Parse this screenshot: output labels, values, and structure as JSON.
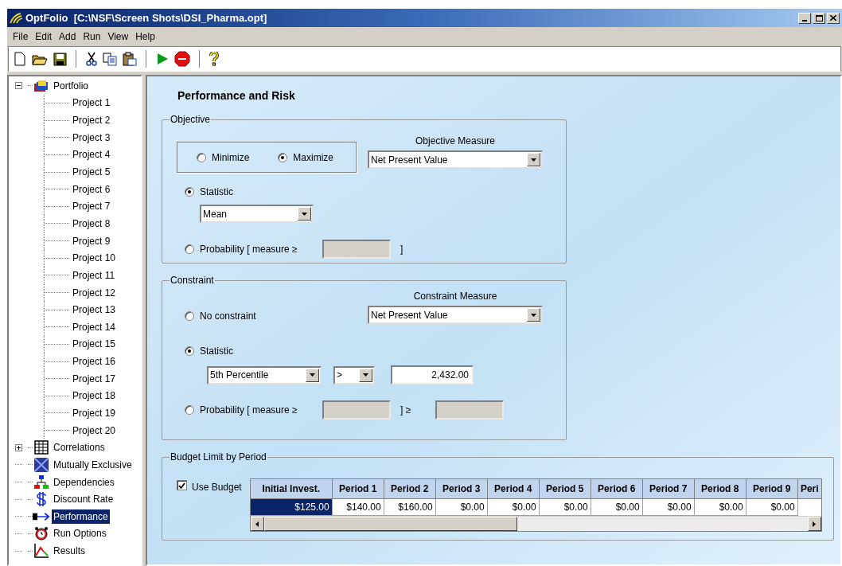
{
  "window": {
    "title": "OptFolio  [C:\\NSF\\Screen Shots\\DSI_Pharma.opt]"
  },
  "menu": [
    "File",
    "Edit",
    "Add",
    "Run",
    "View",
    "Help"
  ],
  "toolbar": [
    {
      "kind": "new"
    },
    {
      "kind": "open"
    },
    {
      "kind": "save"
    },
    {
      "kind": "separator"
    },
    {
      "kind": "cut"
    },
    {
      "kind": "copy"
    },
    {
      "kind": "paste"
    },
    {
      "kind": "separator"
    },
    {
      "kind": "run"
    },
    {
      "kind": "stop"
    },
    {
      "kind": "separator"
    },
    {
      "kind": "help"
    }
  ],
  "tree": [
    {
      "label": "Portfolio",
      "kind": "portfolio",
      "expanded": true,
      "selected": false,
      "children": [
        {
          "label": "Project 1"
        },
        {
          "label": "Project 2"
        },
        {
          "label": "Project 3"
        },
        {
          "label": "Project 4"
        },
        {
          "label": "Project 5"
        },
        {
          "label": "Project 6"
        },
        {
          "label": "Project 7"
        },
        {
          "label": "Project 8"
        },
        {
          "label": "Project 9"
        },
        {
          "label": "Project 10"
        },
        {
          "label": "Project 11"
        },
        {
          "label": "Project 12"
        },
        {
          "label": "Project 13"
        },
        {
          "label": "Project 14"
        },
        {
          "label": "Project 15"
        },
        {
          "label": "Project 16"
        },
        {
          "label": "Project 17"
        },
        {
          "label": "Project 18"
        },
        {
          "label": "Project 19"
        },
        {
          "label": "Project 20"
        }
      ]
    },
    {
      "label": "Correlations",
      "kind": "grid",
      "expanded": false,
      "selected": false
    },
    {
      "label": "Mutually Exclusive",
      "kind": "exclusive",
      "selected": false
    },
    {
      "label": "Dependencies",
      "kind": "dependencies",
      "selected": false
    },
    {
      "label": "Discount Rate",
      "kind": "dollar",
      "selected": false
    },
    {
      "label": "Performance",
      "kind": "arrow",
      "selected": true
    },
    {
      "label": "Run Options",
      "kind": "clock",
      "selected": false
    },
    {
      "label": "Results",
      "kind": "chart",
      "selected": false
    }
  ],
  "panel": {
    "title": "Performance and Risk",
    "objective": {
      "legend": "Objective",
      "direction": [
        {
          "label": "Minimize",
          "selected": false
        },
        {
          "label": "Maximize",
          "selected": true
        }
      ],
      "measure_label": "Objective Measure",
      "measure": "Net Present Value",
      "statistic": {
        "label": "Statistic",
        "selected": true,
        "value": "Mean"
      },
      "probability": {
        "label": "Probability [ measure ≥",
        "selected": false,
        "close": "]"
      }
    },
    "constraint": {
      "legend": "Constraint",
      "none": {
        "label": "No constraint",
        "selected": false
      },
      "measure_label": "Constraint Measure",
      "measure": "Net Present Value",
      "statistic": {
        "label": "Statistic",
        "selected": true,
        "value": "5th Percentile",
        "operator": ">",
        "threshold": "2,432.00"
      },
      "probability": {
        "label": "Probability [ measure ≥",
        "selected": false,
        "close": "] ≥"
      }
    },
    "budget": {
      "legend": "Budget Limit by Period",
      "use_budget": {
        "label": "Use Budget",
        "checked": true
      },
      "columns": [
        "Initial Invest.",
        "Period 1",
        "Period 2",
        "Period 3",
        "Period 4",
        "Period 5",
        "Period 6",
        "Period 7",
        "Period 8",
        "Period 9",
        "Peri"
      ],
      "row": [
        {
          "value": "$125.00",
          "selected": true
        },
        {
          "value": "$140.00",
          "selected": false
        },
        {
          "value": "$160.00",
          "selected": false
        },
        {
          "value": "$0.00",
          "selected": false
        },
        {
          "value": "$0.00",
          "selected": false
        },
        {
          "value": "$0.00",
          "selected": false
        },
        {
          "value": "$0.00",
          "selected": false
        },
        {
          "value": "$0.00",
          "selected": false
        },
        {
          "value": "$0.00",
          "selected": false
        },
        {
          "value": "$0.00",
          "selected": false
        }
      ]
    }
  }
}
